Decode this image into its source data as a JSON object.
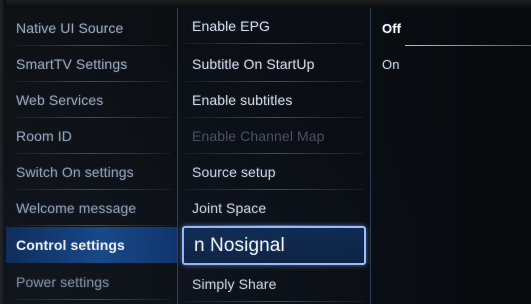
{
  "left_menu": {
    "items": [
      {
        "label": "Native UI Source"
      },
      {
        "label": "SmartTV Settings"
      },
      {
        "label": "Web Services"
      },
      {
        "label": "Room ID"
      },
      {
        "label": "Switch On settings"
      },
      {
        "label": "Welcome message"
      },
      {
        "label": "Control settings"
      },
      {
        "label": "Power settings"
      }
    ],
    "active_index": 6
  },
  "middle_menu": {
    "items": [
      {
        "label": "Enable EPG"
      },
      {
        "label": "Subtitle On StartUp"
      },
      {
        "label": "Enable subtitles"
      },
      {
        "label": "Enable Channel Map",
        "disabled": true
      },
      {
        "label": "Source setup"
      },
      {
        "label": "Joint Space"
      },
      {
        "label": "n Nosignal",
        "selected": true
      },
      {
        "label": "Simply Share"
      }
    ]
  },
  "right_menu": {
    "options": [
      {
        "label": "Off",
        "current": true
      },
      {
        "label": "On"
      }
    ]
  },
  "colors": {
    "active_highlight": "#164a8e",
    "selection_border": "#9fc3ff",
    "background": "#050607"
  }
}
